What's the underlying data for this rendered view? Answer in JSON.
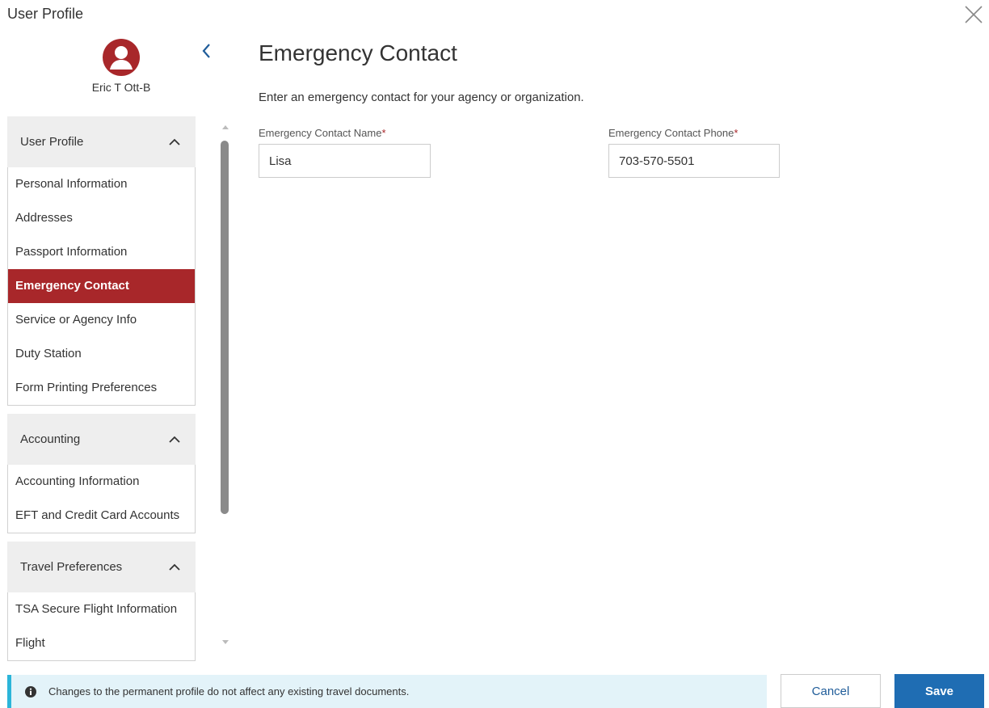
{
  "header": {
    "title": "User Profile"
  },
  "user": {
    "name": "Eric T Ott-B",
    "avatar_color": "#a8272a"
  },
  "sidebar": {
    "groups": [
      {
        "label": "User Profile",
        "items": [
          {
            "label": "Personal Information"
          },
          {
            "label": "Addresses"
          },
          {
            "label": "Passport Information"
          },
          {
            "label": "Emergency Contact",
            "active": true
          },
          {
            "label": "Service or Agency Info"
          },
          {
            "label": "Duty Station"
          },
          {
            "label": "Form Printing Preferences"
          }
        ]
      },
      {
        "label": "Accounting",
        "items": [
          {
            "label": "Accounting Information"
          },
          {
            "label": "EFT and Credit Card Accounts"
          }
        ]
      },
      {
        "label": "Travel Preferences",
        "items": [
          {
            "label": "TSA Secure Flight Information"
          },
          {
            "label": "Flight"
          }
        ]
      }
    ]
  },
  "main": {
    "title": "Emergency Contact",
    "description": "Enter an emergency contact for your agency or organization.",
    "fields": {
      "name": {
        "label": "Emergency Contact Name",
        "required_mark": "*",
        "value": "Lisa"
      },
      "phone": {
        "label": "Emergency Contact Phone",
        "required_mark": "*",
        "value": "703-570-5501"
      }
    }
  },
  "footer": {
    "info_text": "Changes to the permanent profile do not affect any existing travel documents.",
    "cancel_label": "Cancel",
    "save_label": "Save"
  },
  "icons": {
    "close": "close-icon",
    "back": "chevron-left-icon",
    "collapse": "chevron-up-icon",
    "info": "info-icon",
    "avatar": "user-avatar-icon"
  },
  "colors": {
    "accent_red": "#a8272a",
    "primary_blue": "#1f6db3",
    "info_bg": "#e3f3f9",
    "info_border": "#2bb5d9"
  }
}
